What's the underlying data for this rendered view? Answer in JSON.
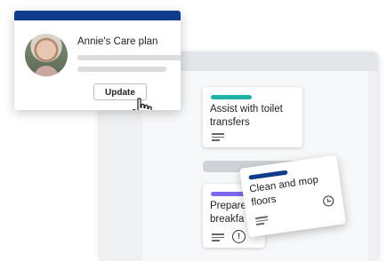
{
  "care_plan": {
    "title": "Annie's Care plan",
    "update_label": "Update"
  },
  "tasks": {
    "toilet": {
      "title_line1": "Assist with toilet",
      "title_line2": "transfers",
      "tag_color": "#1fb3a4"
    },
    "breakfast": {
      "title_line1": "Prepare",
      "title_line2": "breakfa",
      "tag_color": "#7b68ee"
    },
    "clean": {
      "title_line1": "Clean and mop",
      "title_line2": "floors",
      "tag_color": "#0f3c8a"
    }
  },
  "icons": {
    "description": "lines-icon",
    "alert": "alert-icon",
    "clock": "clock-icon",
    "cursor": "hand-pointer-icon"
  },
  "alert_glyph": "!",
  "colors": {
    "header": "#0f3c8a",
    "board_bg": "#eef0f2"
  }
}
